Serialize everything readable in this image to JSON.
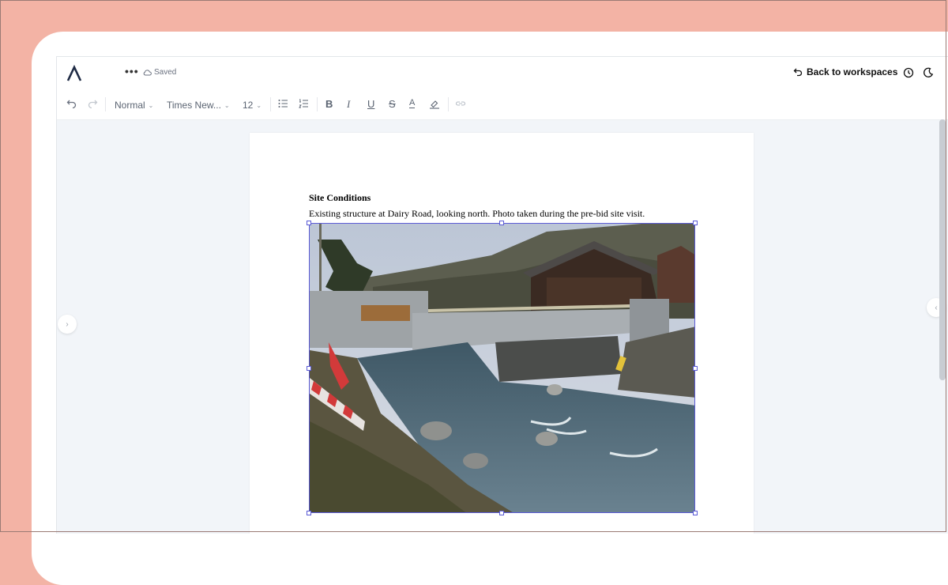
{
  "app": {
    "save_status": "Saved",
    "more_label": "•••",
    "back_label": "Back to workspaces"
  },
  "toolbar": {
    "style_value": "Normal",
    "font_value": "Times New...",
    "size_value": "12",
    "bold_glyph": "B",
    "italic_glyph": "I",
    "underline_glyph": "U",
    "strike_glyph": "S",
    "color_glyph": "A"
  },
  "document": {
    "heading": "Site Conditions",
    "caption": "Existing structure at Dairy Road, looking north. Photo taken during the pre-bid site visit."
  },
  "icons": [
    "logo-icon",
    "cloud-icon",
    "undo-icon",
    "redo-icon",
    "bullet-list-icon",
    "numbered-list-icon",
    "text-color-icon",
    "highlight-icon",
    "link-icon",
    "back-arrow-icon",
    "history-icon",
    "moon-icon",
    "chevron-right-icon",
    "chevron-left-icon"
  ],
  "colors": {
    "accent": "#5b5bd6",
    "background": "#f3b3a5",
    "canvas": "#f2f5f9"
  }
}
